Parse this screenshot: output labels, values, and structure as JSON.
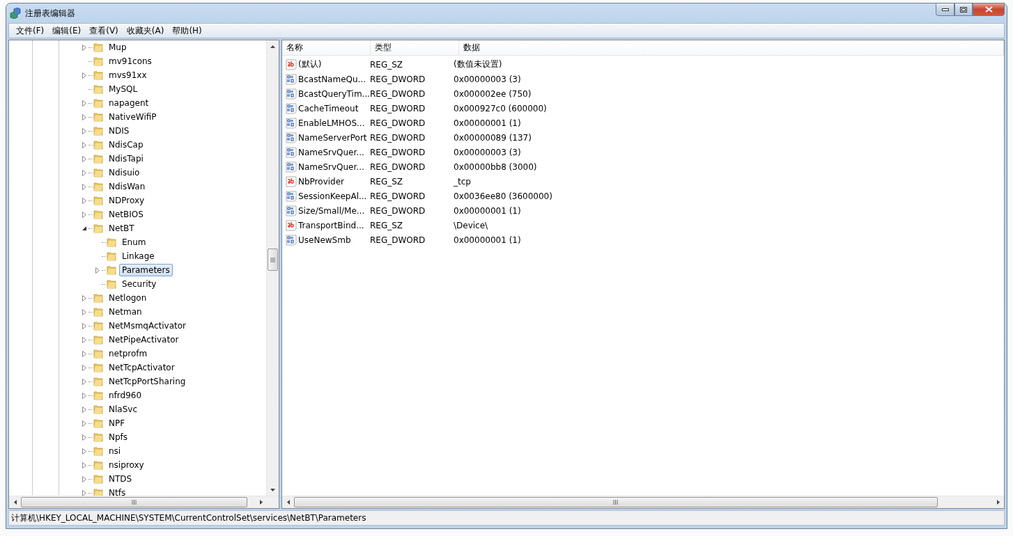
{
  "window": {
    "title": "注册表编辑器"
  },
  "menu": [
    "文件(F)",
    "编辑(E)",
    "查看(V)",
    "收藏夹(A)",
    "帮助(H)"
  ],
  "tree": [
    {
      "label": "Mup",
      "expanded": false,
      "selected": false
    },
    {
      "label": "mv91cons",
      "selected": false
    },
    {
      "label": "mvs91xx",
      "expanded": false,
      "selected": false
    },
    {
      "label": "MySQL",
      "selected": false
    },
    {
      "label": "napagent",
      "expanded": false,
      "selected": false
    },
    {
      "label": "NativeWifiP",
      "expanded": false,
      "selected": false
    },
    {
      "label": "NDIS",
      "expanded": false,
      "selected": false
    },
    {
      "label": "NdisCap",
      "expanded": false,
      "selected": false
    },
    {
      "label": "NdisTapi",
      "expanded": false,
      "selected": false
    },
    {
      "label": "Ndisuio",
      "expanded": false,
      "selected": false
    },
    {
      "label": "NdisWan",
      "expanded": false,
      "selected": false
    },
    {
      "label": "NDProxy",
      "expanded": false,
      "selected": false
    },
    {
      "label": "NetBIOS",
      "expanded": false,
      "selected": false
    },
    {
      "label": "NetBT",
      "expanded": true,
      "selected": false,
      "children": [
        {
          "label": "Enum",
          "selected": false
        },
        {
          "label": "Linkage",
          "selected": false
        },
        {
          "label": "Parameters",
          "expanded": false,
          "selected": true
        },
        {
          "label": "Security",
          "selected": false
        }
      ]
    },
    {
      "label": "Netlogon",
      "expanded": false,
      "selected": false
    },
    {
      "label": "Netman",
      "expanded": false,
      "selected": false
    },
    {
      "label": "NetMsmqActivator",
      "expanded": false,
      "selected": false
    },
    {
      "label": "NetPipeActivator",
      "expanded": false,
      "selected": false
    },
    {
      "label": "netprofm",
      "expanded": false,
      "selected": false
    },
    {
      "label": "NetTcpActivator",
      "expanded": false,
      "selected": false
    },
    {
      "label": "NetTcpPortSharing",
      "expanded": false,
      "selected": false
    },
    {
      "label": "nfrd960",
      "expanded": false,
      "selected": false
    },
    {
      "label": "NlaSvc",
      "expanded": false,
      "selected": false
    },
    {
      "label": "NPF",
      "expanded": false,
      "selected": false
    },
    {
      "label": "Npfs",
      "expanded": false,
      "selected": false
    },
    {
      "label": "nsi",
      "expanded": false,
      "selected": false
    },
    {
      "label": "nsiproxy",
      "expanded": false,
      "selected": false
    },
    {
      "label": "NTDS",
      "expanded": false,
      "selected": false
    },
    {
      "label": "Ntfs",
      "expanded": false,
      "selected": false
    }
  ],
  "list": {
    "columns": [
      "名称",
      "类型",
      "数据"
    ],
    "rows": [
      {
        "kind": "string",
        "name": "(默认)",
        "type": "REG_SZ",
        "data": "(数值未设置)"
      },
      {
        "kind": "binary",
        "name": "BcastNameQu...",
        "type": "REG_DWORD",
        "data": "0x00000003 (3)"
      },
      {
        "kind": "binary",
        "name": "BcastQueryTim...",
        "type": "REG_DWORD",
        "data": "0x000002ee (750)"
      },
      {
        "kind": "binary",
        "name": "CacheTimeout",
        "type": "REG_DWORD",
        "data": "0x000927c0 (600000)"
      },
      {
        "kind": "binary",
        "name": "EnableLMHOS...",
        "type": "REG_DWORD",
        "data": "0x00000001 (1)"
      },
      {
        "kind": "binary",
        "name": "NameServerPort",
        "type": "REG_DWORD",
        "data": "0x00000089 (137)"
      },
      {
        "kind": "binary",
        "name": "NameSrvQuer...",
        "type": "REG_DWORD",
        "data": "0x00000003 (3)"
      },
      {
        "kind": "binary",
        "name": "NameSrvQuer...",
        "type": "REG_DWORD",
        "data": "0x00000bb8 (3000)"
      },
      {
        "kind": "string",
        "name": "NbProvider",
        "type": "REG_SZ",
        "data": "_tcp"
      },
      {
        "kind": "binary",
        "name": "SessionKeepAl...",
        "type": "REG_DWORD",
        "data": "0x0036ee80 (3600000)"
      },
      {
        "kind": "binary",
        "name": "Size/Small/Me...",
        "type": "REG_DWORD",
        "data": "0x00000001 (1)"
      },
      {
        "kind": "string",
        "name": "TransportBind...",
        "type": "REG_SZ",
        "data": "\\Device\\"
      },
      {
        "kind": "binary",
        "name": "UseNewSmb",
        "type": "REG_DWORD",
        "data": "0x00000001 (1)"
      }
    ]
  },
  "status_bar": "计算机\\HKEY_LOCAL_MACHINE\\SYSTEM\\CurrentControlSet\\services\\NetBT\\Parameters"
}
